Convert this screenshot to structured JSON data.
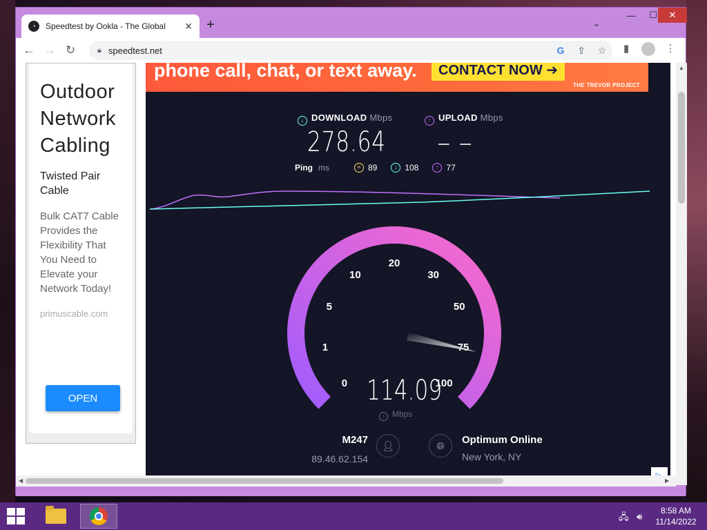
{
  "browser": {
    "tab_title": "Speedtest by Ookla - The Global",
    "tab_close": "✕",
    "new_tab": "+",
    "url": "speedtest.net",
    "window_controls": {
      "minimize": "—",
      "maximize": "☐",
      "close": "✕"
    }
  },
  "ad": {
    "title_lines": [
      "Outdoor",
      "Network",
      "Cabling"
    ],
    "subtitle_lines": [
      "Twisted Pair",
      "Cable"
    ],
    "body_lines": [
      "Bulk CAT7 Cable",
      "Provides the",
      "Flexibility That",
      "You Need to",
      "Elevate your",
      "Network Today!"
    ],
    "domain": "primuscable.com",
    "cta": "OPEN"
  },
  "banner": {
    "text": "phone call, chat, or text away.",
    "button": "CONTACT NOW ➔",
    "brand": "THE TREVOR PROJECT"
  },
  "speedtest": {
    "download_label": "DOWNLOAD",
    "download_unit": "Mbps",
    "download_value": "278.64",
    "upload_label": "UPLOAD",
    "upload_unit": "Mbps",
    "upload_value": "– –",
    "ping_label": "Ping",
    "ping_unit": "ms",
    "ping_idle": "89",
    "ping_download": "108",
    "ping_upload": "77",
    "gauge_value": "114.09",
    "gauge_unit": "Mbps",
    "gauge_ticks": [
      "0",
      "1",
      "5",
      "10",
      "20",
      "30",
      "50",
      "75",
      "100"
    ],
    "gauge_level": 0.88,
    "server_host": "M247",
    "server_ip": "89.46.62.154",
    "isp_name": "Optimum Online",
    "isp_location": "New York, NY",
    "colors": {
      "download": "#6afff3",
      "upload": "#bf71ff",
      "ping": "#fbe066",
      "gauge_start": "#9d5cff",
      "gauge_end": "#ff6ac8"
    }
  },
  "taskbar": {
    "time": "8:58 AM",
    "date": "11/14/2022"
  }
}
